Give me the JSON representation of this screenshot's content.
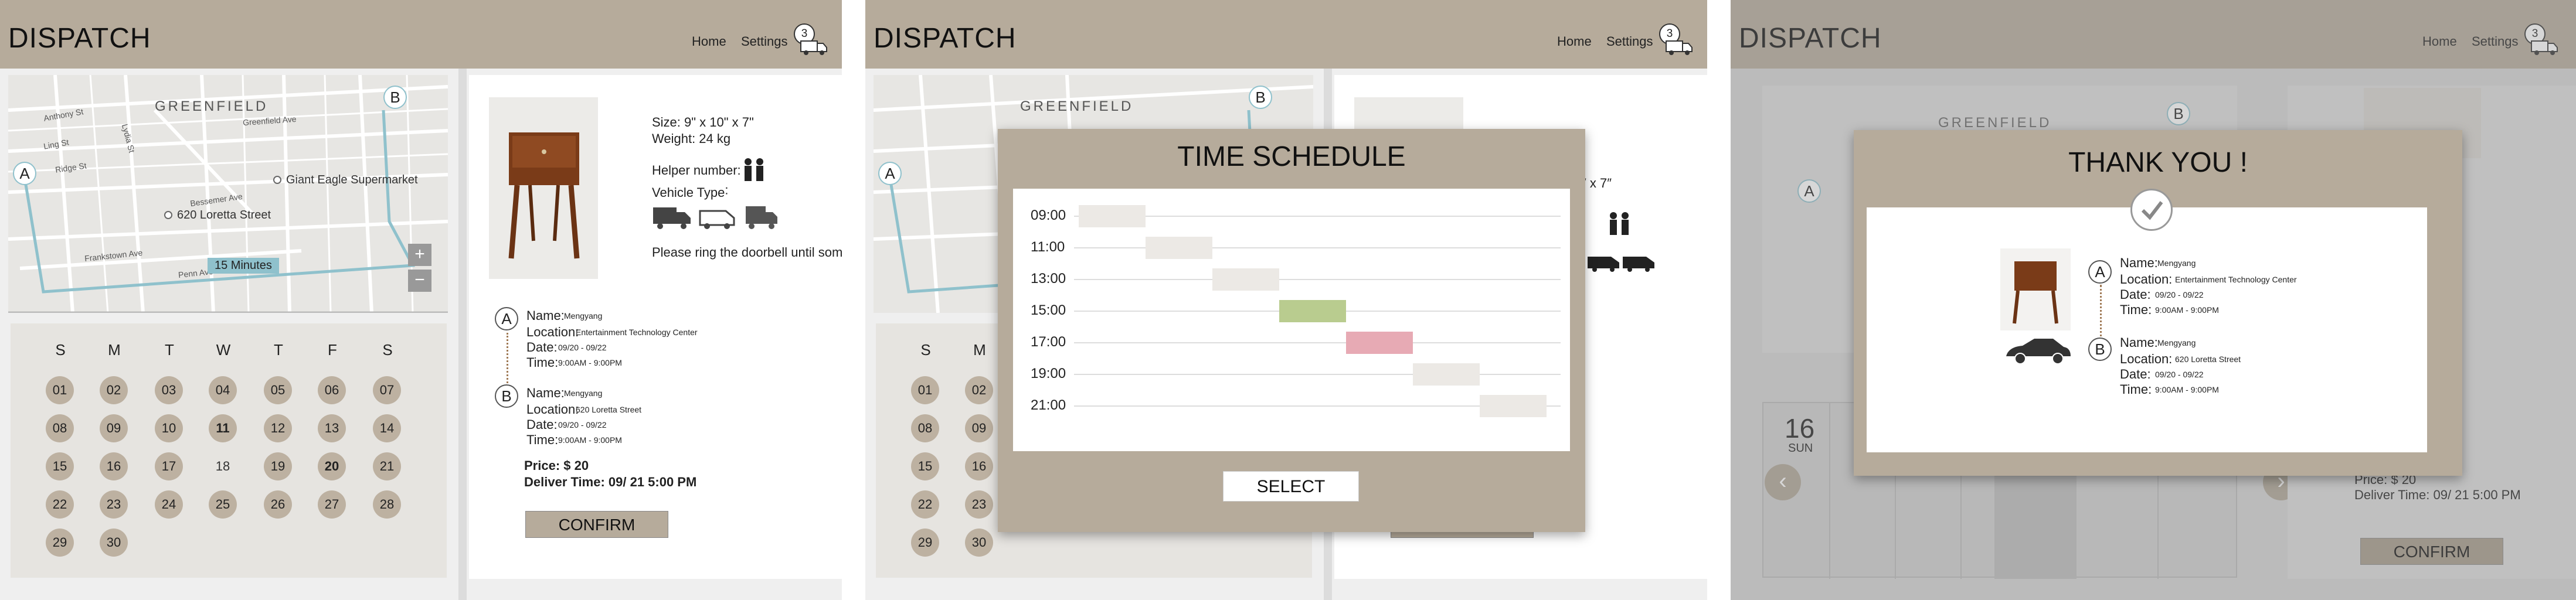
{
  "app": {
    "logo": "DISPATCH",
    "nav_home": "Home",
    "nav_settings": "Settings",
    "cart_count": "3"
  },
  "map": {
    "neighborhood": "GREENFIELD",
    "streets": [
      "Anthony St",
      "Ling St",
      "Ridge St",
      "Bessemer Ave",
      "Lydia St",
      "Penn Ave",
      "Frankstown Ave",
      "Greenfield Ave"
    ],
    "poi_supermarket": "Giant Eagle Supermarket",
    "poi_address": "620 Loretta Street",
    "route_time": "15 Minutes",
    "pin_a": "A",
    "pin_b": "B",
    "zoom_in": "+",
    "zoom_out": "−"
  },
  "calendar": {
    "weekdays": [
      "S",
      "M",
      "T",
      "W",
      "T",
      "F",
      "S"
    ],
    "days": [
      "01",
      "02",
      "03",
      "04",
      "05",
      "06",
      "07",
      "08",
      "09",
      "10",
      "11",
      "12",
      "13",
      "14",
      "15",
      "16",
      "17",
      "18",
      "19",
      "20",
      "21",
      "22",
      "23",
      "24",
      "25",
      "26",
      "27",
      "28",
      "29",
      "30"
    ]
  },
  "product": {
    "size": "Size: 9\" x 10\" x 7\"",
    "weight": "Weight:  24 kg",
    "helper_label": "Helper number:",
    "vehicle_label": "Vehicle Type˸",
    "note": "Please ring the doorbell until someo"
  },
  "pickup": {
    "letter": "A",
    "name_label": "Name:",
    "name": "Mengyang",
    "location_label": "Location:",
    "location": "Entertainment Technology Center",
    "date_label": "Date:",
    "date": "09/20 - 09/22",
    "time_label": "Time:",
    "time": "9:00AM - 9:00PM"
  },
  "dropoff": {
    "letter": "B",
    "name_label": "Name:",
    "name": "Mengyang",
    "location_label": "Location:",
    "location": "620 Loretta Street",
    "date_label": "Date:",
    "date": "09/20 - 09/22",
    "time_label": "Time:",
    "time": "9:00AM - 9:00PM"
  },
  "price": "Price: $ 20",
  "deliver_time": "Deliver Time: 09/ 21 5:00 PM",
  "confirm": "CONFIRM",
  "schedule": {
    "title": "TIME SCHEDULE",
    "times": [
      "09:00",
      "11:00",
      "13:00",
      "15:00",
      "17:00",
      "19:00",
      "21:00"
    ],
    "select": "SELECT",
    "colors": {
      "neutral": "#ece9e5",
      "available": "#b9cc8f",
      "busy": "#e7aab4"
    }
  },
  "thanks": {
    "title": "THANK YOU !",
    "date_num": "16",
    "date_day": "SUN"
  }
}
